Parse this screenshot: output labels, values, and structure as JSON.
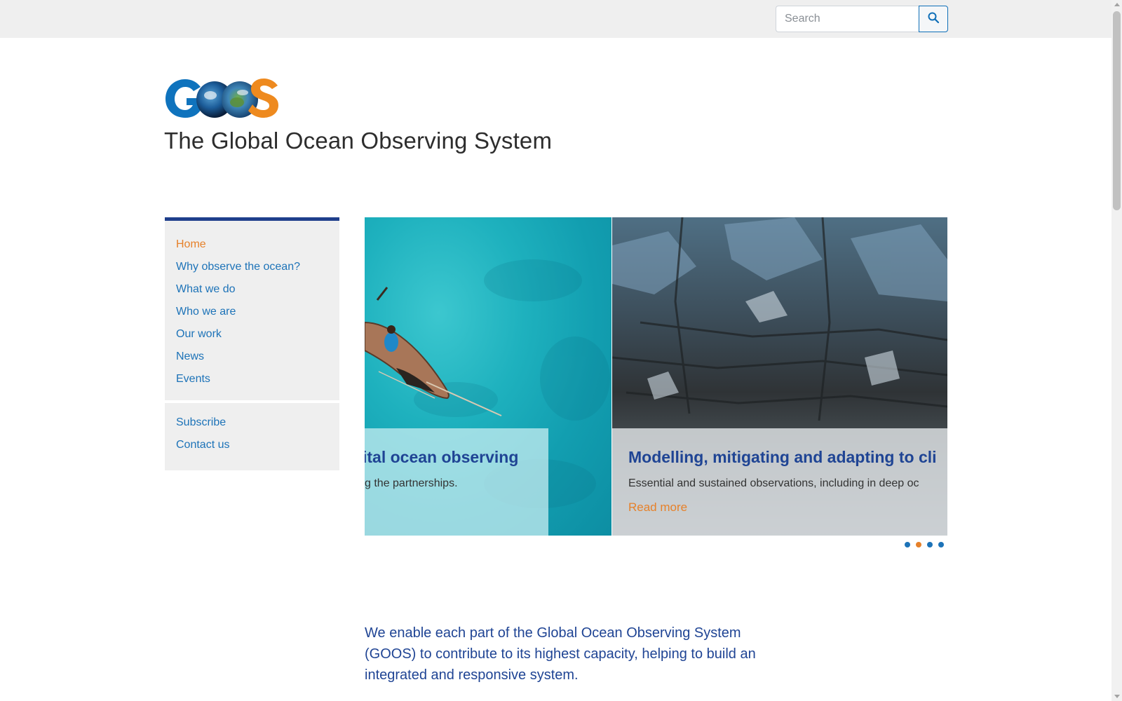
{
  "header": {
    "search": {
      "placeholder": "Search",
      "value": ""
    },
    "search_button_icon": "search-icon"
  },
  "brand": {
    "logo_text": "GOOS",
    "title": "The Global Ocean Observing System"
  },
  "sidebar": {
    "primary_items": [
      {
        "label": "Home",
        "active": true
      },
      {
        "label": "Why observe the ocean?",
        "active": false
      },
      {
        "label": "What we do",
        "active": false
      },
      {
        "label": "Who we are",
        "active": false
      },
      {
        "label": "Our work",
        "active": false
      },
      {
        "label": "News",
        "active": false
      },
      {
        "label": "Events",
        "active": false
      }
    ],
    "secondary_items": [
      {
        "label": "Subscribe"
      },
      {
        "label": "Contact us"
      }
    ]
  },
  "carousel": {
    "slides": [
      {
        "title": "ital ocean observing",
        "text": "g the partnerships."
      },
      {
        "title": "Modelling, mitigating and adapting to cli",
        "text": "Essential and sustained observations, including in deep oc",
        "link": "Read more"
      }
    ],
    "dots": [
      false,
      true,
      false,
      false
    ]
  },
  "intro": {
    "text": "We enable each part of the Global Ocean Observing System (GOOS) to contribute to its highest capacity, helping to build an integrated and responsive system."
  },
  "colors": {
    "nav_link": "#1d73b8",
    "nav_active": "#e6812a",
    "heading_blue": "#1f4494",
    "accent_bar": "#1f3f8c"
  }
}
